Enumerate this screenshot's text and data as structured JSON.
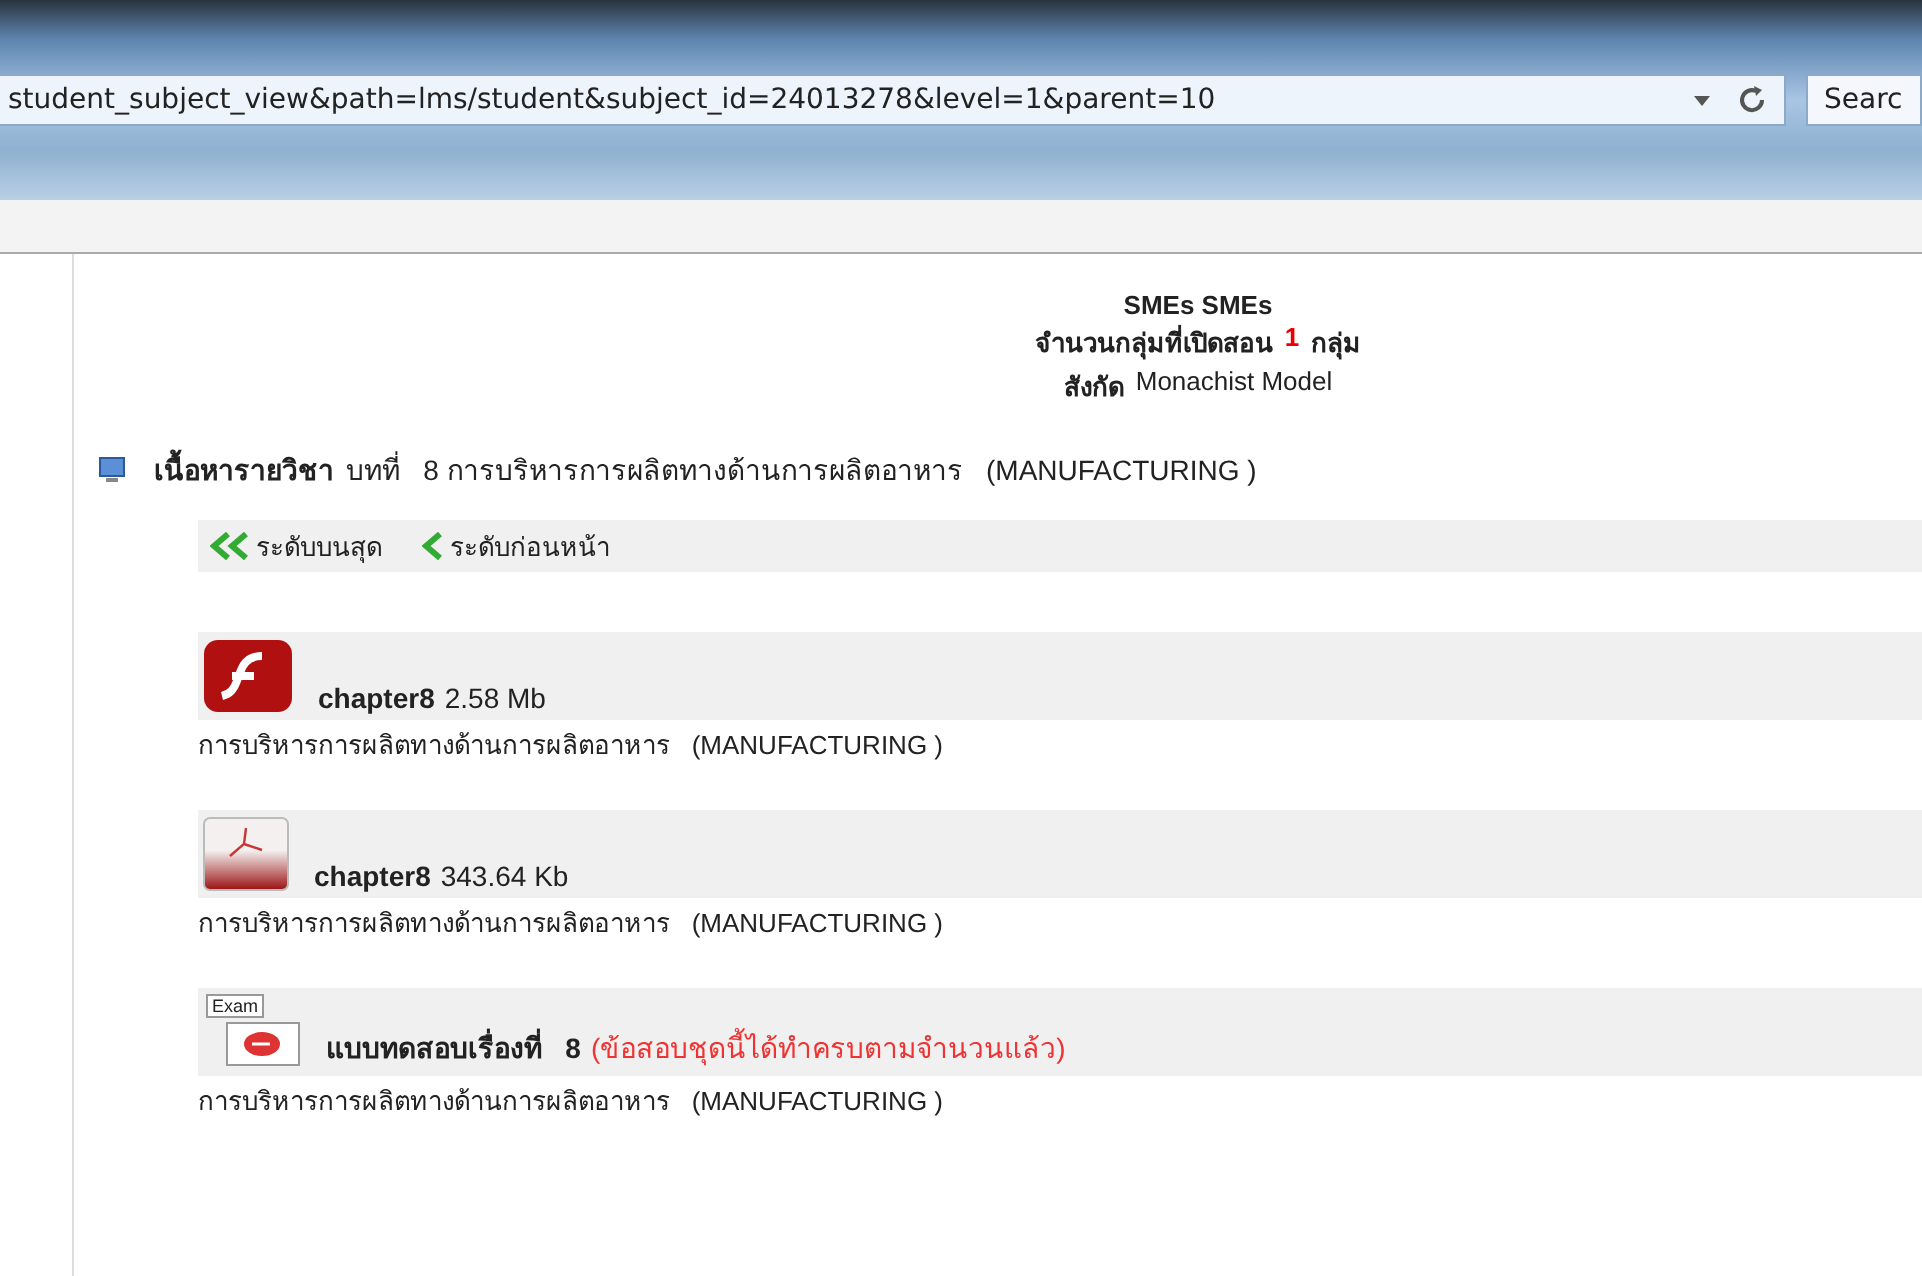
{
  "browser": {
    "address": "student_subject_view&path=lms/student&subject_id=24013278&level=1&parent=10",
    "search_button": "Searc"
  },
  "header": {
    "title": "SMEs SMEs",
    "groups_label": "จำนวนกลุ่มที่เปิดสอน",
    "groups_count": "1",
    "groups_unit": "กลุ่ม",
    "affiliation_label": "สังกัด",
    "affiliation": "Monachist Model"
  },
  "content": {
    "label": "เนื้อหารายวิชา",
    "lesson": "บทที่   8 การบริหารการผลิตทางด้านการผลิตอาหาร   (MANUFACTURING )"
  },
  "nav": [
    {
      "label": "ระดับบนสุด",
      "kind": "double"
    },
    {
      "label": "ระดับก่อนหน้า",
      "kind": "single"
    }
  ],
  "items": [
    {
      "kind": "flash",
      "name": "chapter8",
      "size": "2.58 Mb",
      "description": "การบริหารการผลิตทางด้านการผลิตอาหาร   (MANUFACTURING )"
    },
    {
      "kind": "pdf",
      "name": "chapter8",
      "size": "343.64 Kb",
      "description": "การบริหารการผลิตทางด้านการผลิตอาหาร   (MANUFACTURING )"
    },
    {
      "kind": "exam",
      "icon_label": "Exam",
      "name": "แบบทดสอบเรื่องที่   8",
      "note": "(ข้อสอบชุดนี้ได้ทำครบตามจำนวนแล้ว)",
      "description": "การบริหารการผลิตทางด้านการผลิตอาหาร   (MANUFACTURING )"
    }
  ]
}
